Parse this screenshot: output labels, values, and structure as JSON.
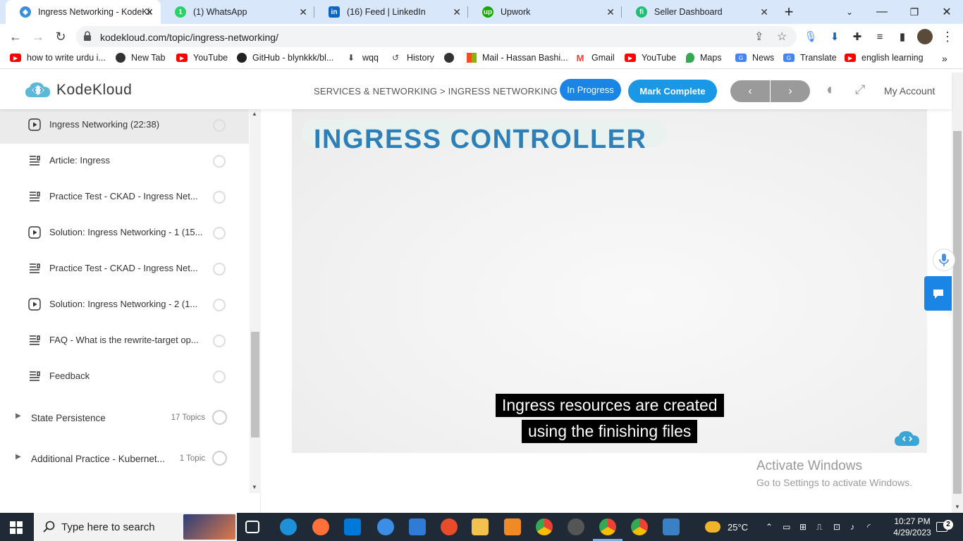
{
  "browser": {
    "tabs": [
      {
        "title": "Ingress Networking - KodeKloud",
        "icon": "kodekloud-icon",
        "color": "#3b8fd9"
      },
      {
        "title": "(1) WhatsApp",
        "icon": "whatsapp-icon",
        "color": "#25d366"
      },
      {
        "title": "(16) Feed | LinkedIn",
        "icon": "linkedin-icon",
        "color": "#0a66c2"
      },
      {
        "title": "Upwork",
        "icon": "upwork-icon",
        "color": "#14a800"
      },
      {
        "title": "Seller Dashboard",
        "icon": "fiverr-icon",
        "color": "#1dbf73"
      }
    ],
    "url": "kodekloud.com/topic/ingress-networking/",
    "bookmarks": [
      {
        "label": "how to write urdu i...",
        "icon": "youtube-icon",
        "color": "#ff0000"
      },
      {
        "label": "New Tab",
        "icon": "globe-icon",
        "color": "#333333"
      },
      {
        "label": "YouTube",
        "icon": "youtube-icon",
        "color": "#ff0000"
      },
      {
        "label": "GitHub - blynkkk/bl...",
        "icon": "github-icon",
        "color": "#222222"
      },
      {
        "label": "wqq",
        "icon": "download-icon",
        "color": "#444444"
      },
      {
        "label": "History",
        "icon": "history-icon",
        "color": "#444444"
      },
      {
        "label": "",
        "icon": "globe-icon",
        "color": "#333333"
      },
      {
        "label": "Mail - Hassan Bashi...",
        "icon": "microsoft-icon",
        "color": "#f25022"
      },
      {
        "label": "Gmail",
        "icon": "gmail-icon",
        "color": "#ea4335"
      },
      {
        "label": "YouTube",
        "icon": "youtube-icon",
        "color": "#ff0000"
      },
      {
        "label": "Maps",
        "icon": "maps-icon",
        "color": "#34a853"
      },
      {
        "label": "News",
        "icon": "news-icon",
        "color": "#4285f4"
      },
      {
        "label": "Translate",
        "icon": "translate-icon",
        "color": "#4285f4"
      },
      {
        "label": "english learning",
        "icon": "youtube-icon",
        "color": "#ff0000"
      }
    ]
  },
  "header": {
    "brand": "KodeKloud",
    "breadcrumb": "SERVICES & NETWORKING > INGRESS NETWORKING",
    "status_label": "In Progress",
    "complete_label": "Mark Complete",
    "prev_label": "‹",
    "next_label": "›",
    "account_label": "My Account"
  },
  "sidebar": {
    "lessons": [
      {
        "title": "Ingress Networking (22:38)",
        "icon": "play-icon",
        "current": true
      },
      {
        "title": "Article: Ingress",
        "icon": "article-icon",
        "current": false
      },
      {
        "title": "Practice Test - CKAD - Ingress Net...",
        "icon": "article-icon",
        "current": false
      },
      {
        "title": "Solution: Ingress Networking - 1 (15...",
        "icon": "play-icon",
        "current": false
      },
      {
        "title": "Practice Test - CKAD - Ingress Net...",
        "icon": "article-icon",
        "current": false
      },
      {
        "title": "Solution: Ingress Networking - 2 (1...",
        "icon": "play-icon",
        "current": false
      },
      {
        "title": "FAQ - What is the rewrite-target op...",
        "icon": "article-icon",
        "current": false
      },
      {
        "title": "Feedback",
        "icon": "article-icon",
        "current": false
      }
    ],
    "sections": [
      {
        "title": "State Persistence",
        "count": "17 Topics"
      },
      {
        "title": "Additional Practice - Kubernet...",
        "count": "1 Topic"
      }
    ]
  },
  "video": {
    "slide_title": "INGRESS CONTROLLER",
    "caption_line1": "Ingress resources are created",
    "caption_line2": "using the finishing files"
  },
  "watermark": {
    "line1": "Activate Windows",
    "line2": "Go to Settings to activate Windows."
  },
  "taskbar": {
    "search_placeholder": "Type here to search",
    "weather": "25°C",
    "time": "10:27 PM",
    "date": "4/29/2023",
    "notifications": "2"
  }
}
